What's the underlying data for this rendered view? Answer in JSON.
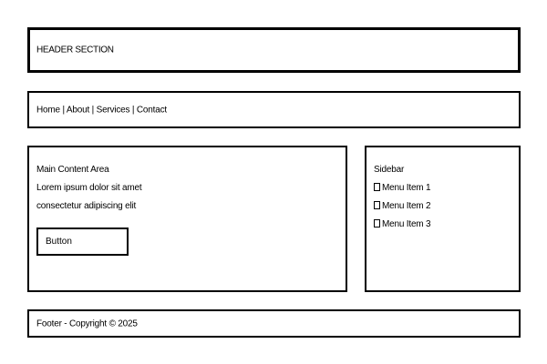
{
  "header": {
    "title": "HEADER SECTION"
  },
  "nav": {
    "links": [
      "Home",
      "About",
      "Services",
      "Contact"
    ],
    "separator": " | "
  },
  "main": {
    "heading": "Main Content Area",
    "lines": [
      "Lorem ipsum dolor sit amet",
      "consectetur adipiscing elit"
    ],
    "button_label": "Button"
  },
  "sidebar": {
    "heading": "Sidebar",
    "items": [
      {
        "label": "Menu Item 1",
        "icon": "square-bullet-icon"
      },
      {
        "label": "Menu Item 2",
        "icon": "square-bullet-icon"
      },
      {
        "label": "Menu Item 3",
        "icon": "square-bullet-icon"
      }
    ]
  },
  "footer": {
    "text": "Footer - Copyright © 2025"
  }
}
